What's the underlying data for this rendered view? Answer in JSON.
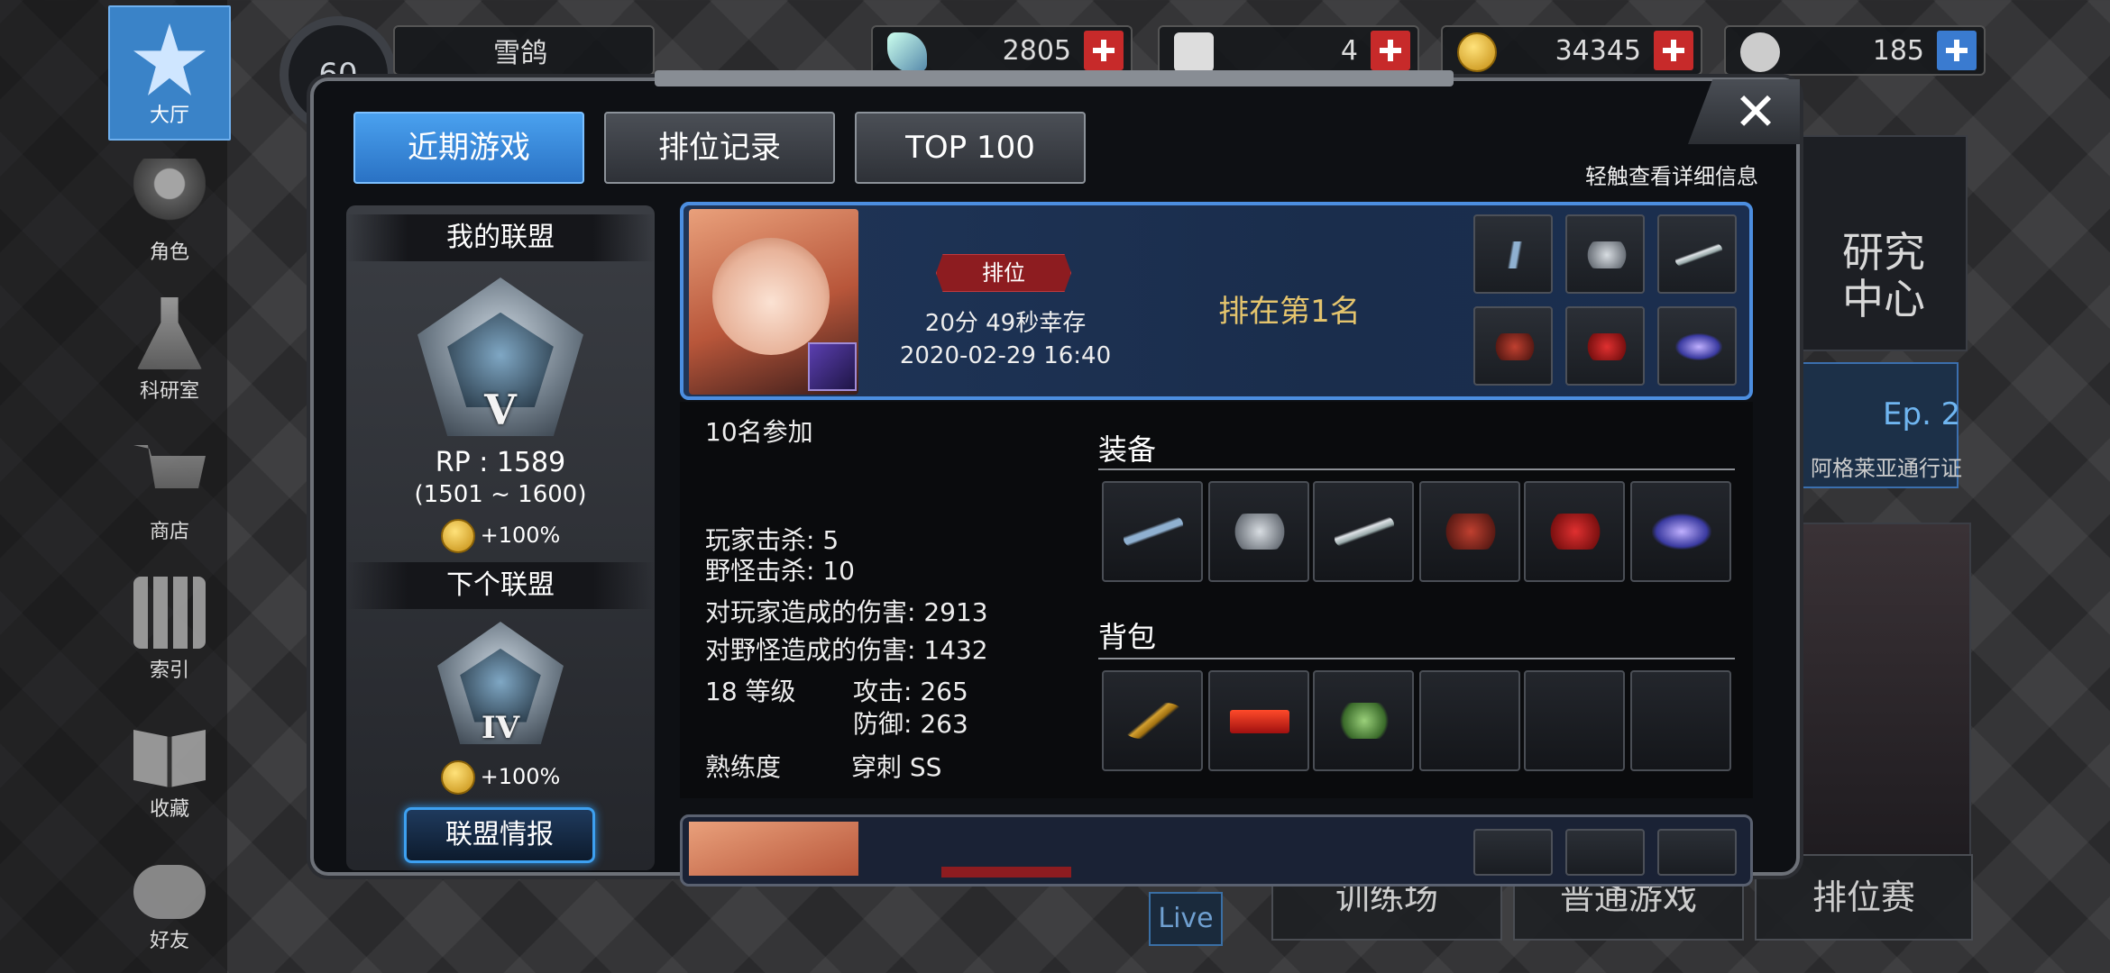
{
  "nav": {
    "lobby": "大厅",
    "character": "角色",
    "lab": "科研室",
    "shop": "商店",
    "index": "索引",
    "collection": "收藏",
    "friends": "好友"
  },
  "topbar": {
    "level": "60",
    "username": "雪鸽",
    "crystals": "2805",
    "tickets": "4",
    "gold": "34345",
    "bp": "185"
  },
  "background": {
    "research_center": "研究\n中心",
    "episode": "Ep. 2",
    "pass": "阿格莱亚通行证",
    "training": "训练场",
    "normal_game": "普通游戏",
    "ranked": "排位赛",
    "live": "Live"
  },
  "tabs": [
    "近期游戏",
    "排位记录",
    "TOP 100"
  ],
  "hint": "轻触查看详细信息",
  "league": {
    "my_title": "我的联盟",
    "my_tier": "V",
    "rp": "RP : 1589",
    "range": "(1501 ~ 1600)",
    "my_bonus": "+100%",
    "next_title": "下个联盟",
    "next_tier": "IV",
    "next_bonus": "+100%",
    "info_button": "联盟情报"
  },
  "match": {
    "mode": "排位",
    "survival": "20分 49秒幸存",
    "datetime": "2020-02-29 16:40",
    "result": "排在第1名",
    "participants": "10名参加",
    "player_kills": "玩家击杀: 5",
    "monster_kills": "野怪击杀: 10",
    "player_damage": "对玩家造成的伤害: 2913",
    "monster_damage": "对野怪造成的伤害: 1432",
    "level": "18 等级",
    "attack": "攻击: 265",
    "defense": "防御: 263",
    "proficiency_label": "熟练度",
    "proficiency_value": "穿刺 SS",
    "equipment_title": "装备",
    "bag_title": "背包",
    "equipment_icons": [
      "spear-icon",
      "helmet-icon",
      "dagger-icon",
      "armor-icon",
      "shoes-icon",
      "nebula-accessory-icon"
    ],
    "bag_icons": [
      "root-icon",
      "bar-icon",
      "herb-icon"
    ]
  },
  "colors": {
    "accent_blue": "#3a8fe8",
    "rank_red": "#8d1c20",
    "gold_text": "#e4c46d"
  }
}
